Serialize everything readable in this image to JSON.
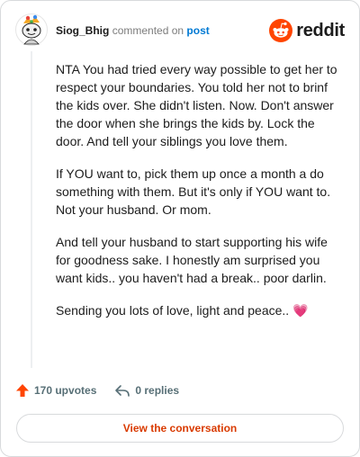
{
  "header": {
    "author": "Siog_Bhig",
    "action": "commented on",
    "post_link": "post",
    "brand": "reddit"
  },
  "comment": {
    "paragraphs": [
      "NTA You had tried every way possible to get her to respect your boundaries. You told her not to brinf the kids over. She didn't listen. Now. Don't answer the door when she brings the kids by. Lock the door. And tell your siblings you love them.",
      "If YOU want to, pick them up once a month a do something with them. But it's only if YOU want to. Not your husband. Or mom.",
      "And tell your husband to start supporting his wife for goodness sake. I honestly am surprised you want kids.. you haven't had a break.. poor darlin.",
      "Sending you lots of love, light and peace.. 💗"
    ]
  },
  "footer": {
    "upvotes": "170 upvotes",
    "replies": "0 replies"
  },
  "cta": {
    "label": "View the conversation"
  },
  "colors": {
    "upvote": "#ff4500",
    "link": "#0079d3",
    "cta_text": "#d93a00",
    "border": "#d8dadc"
  },
  "icons": {
    "avatar": "snoo-avatar-icon",
    "logo": "reddit-logo-icon",
    "upvote": "upvote-arrow-icon",
    "reply": "reply-arrow-icon"
  }
}
